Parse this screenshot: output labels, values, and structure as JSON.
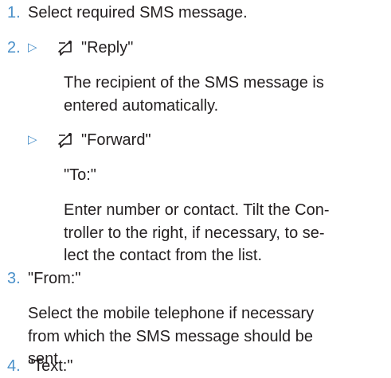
{
  "steps": [
    {
      "num": "1.",
      "text": "Select required SMS message."
    },
    {
      "num": "2."
    },
    {
      "num": "3.",
      "text": "\"From:\""
    },
    {
      "num": "4.",
      "text": "\"Text:\""
    }
  ],
  "reply": {
    "label": "\"Reply\"",
    "description": [
      "The recipient of the SMS message is",
      "entered automatically."
    ]
  },
  "forward": {
    "label": "\"Forward\"",
    "to_label": "\"To:\"",
    "description": [
      "Enter number or contact. Tilt the Con-",
      "troller to the right, if necessary, to se-",
      "lect the contact from the list."
    ]
  },
  "from": {
    "description": [
      "Select the mobile telephone if necessary",
      "from which the SMS message should be",
      "sent."
    ]
  },
  "icons": {
    "arrow": "triangle-right-outline",
    "menu": "options-menu-icon"
  },
  "colors": {
    "accent": "#4a90c9",
    "text": "#231f20"
  }
}
